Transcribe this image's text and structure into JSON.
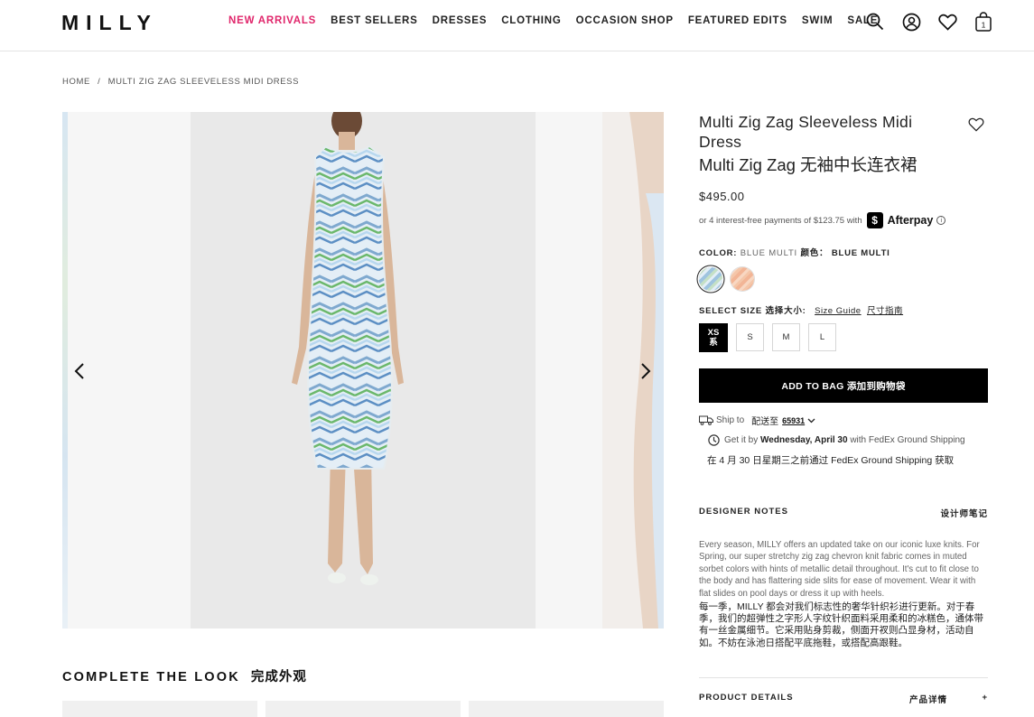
{
  "header": {
    "logo": "MILLY",
    "nav": [
      "NEW ARRIVALS",
      "BEST SELLERS",
      "DRESSES",
      "CLOTHING",
      "OCCASION SHOP",
      "FEATURED EDITS",
      "SWIM",
      "SALE"
    ],
    "cart_count": "1",
    "accent_color": "#e0266b"
  },
  "breadcrumb": {
    "home": "HOME",
    "sep": "/",
    "current": "MULTI ZIG ZAG SLEEVELESS MIDI DRESS"
  },
  "product": {
    "title": "Multi Zig Zag Sleeveless Midi Dress",
    "title_cn": "Multi Zig Zag 无袖中长连衣裙",
    "price": "$495.00",
    "afterpay_text": "or 4 interest-free payments of $123.75 with",
    "afterpay_brand": "Afterpay",
    "color_label": "COLOR:",
    "color_value": "BLUE MULTI",
    "color_label_cn": "颜色：",
    "color_value_cn": "BLUE MULTI",
    "size_label": "SELECT SIZE",
    "size_label_cn": "选择大小:",
    "size_guide": "Size Guide",
    "size_guide_cn": "尺寸指南",
    "sizes": [
      {
        "label": "XS",
        "label_cn": "系"
      },
      {
        "label": "S"
      },
      {
        "label": "M"
      },
      {
        "label": "L"
      }
    ],
    "add_to_bag": "ADD TO BAG 添加到购物袋",
    "ship_to": "Ship to",
    "ship_to_cn": "配送至",
    "zip": "65931",
    "get_it_prefix": "Get it by",
    "get_it_date": "Wednesday, April 30",
    "get_it_suffix": "with FedEx Ground Shipping",
    "get_it_cn": "在 4 月 30 日星期三之前通过 FedEx Ground Shipping 获取"
  },
  "designer_notes": {
    "label": "DESIGNER NOTES",
    "label_cn": "设计师笔记",
    "text": "Every season, MILLY offers an updated take on our iconic luxe knits. For Spring, our super stretchy zig zag chevron knit fabric comes in muted sorbet colors with hints of metallic detail throughout. It's cut to fit close to the body and has flattering side slits for ease of movement. Wear it with flat slides on pool days or dress it up with heels.",
    "text_cn": "每一季，MILLY 都会对我们标志性的奢华针织衫进行更新。对于春季，我们的超弹性之字形人字纹针织面料采用柔和的冰糕色，通体带有一丝金属细节。它采用贴身剪裁，侧面开衩则凸显身材，活动自如。不妨在泳池日搭配平底拖鞋，或搭配高跟鞋。"
  },
  "product_details": {
    "label": "PRODUCT DETAILS",
    "label_cn": "产品详情",
    "toggle": "+"
  },
  "complete_the_look": {
    "label": "COMPLETE THE LOOK",
    "label_cn": "完成外观"
  }
}
